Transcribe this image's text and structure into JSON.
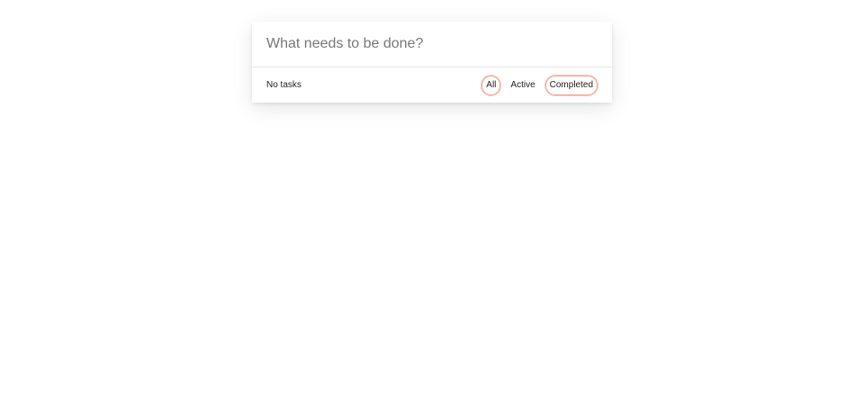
{
  "new_todo": {
    "placeholder": "What needs to be done?"
  },
  "footer": {
    "count_text": "No tasks",
    "filters": [
      {
        "label": "All",
        "selected": true
      },
      {
        "label": "Active",
        "selected": false
      },
      {
        "label": "Completed",
        "selected": false
      }
    ]
  },
  "colors": {
    "filter_outline": "#f2a58e",
    "divider": "#e3e3e3"
  }
}
